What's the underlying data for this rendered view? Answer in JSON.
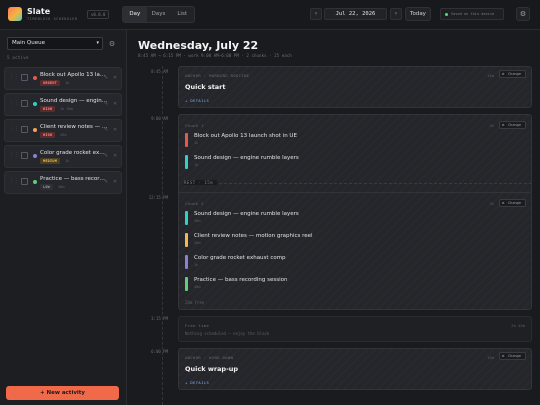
{
  "app": {
    "title": "Slate",
    "subtitle": "TIMEBLOCK SCHEDULER",
    "version": "v0.8.0"
  },
  "views": [
    {
      "label": "Day",
      "active": true
    },
    {
      "label": "Days",
      "active": false
    },
    {
      "label": "List",
      "active": false
    }
  ],
  "nav": {
    "prev_icon": "‹",
    "next_icon": "›",
    "date": "Jul 22, 2026",
    "today_label": "Today",
    "saved_status": "Saved on this device",
    "settings_icon": "⚙"
  },
  "sidebar": {
    "queue": "Main Queue",
    "queue_chevron": "▾",
    "gear_icon": "⚙",
    "active_count": "5 active",
    "tasks": [
      {
        "name": "Block out Apollo 13 launch shot in UE",
        "badge": "URGENT",
        "duration": "1h",
        "color": "#e25a4d",
        "badge_bg": "#5a2b2b",
        "badge_fg": "#ff8f82"
      },
      {
        "name": "Sound design — engine rumble layers",
        "badge": "HIGH",
        "duration": "1h 30m",
        "color": "#2fd1c5",
        "badge_bg": "#5a2b2b",
        "badge_fg": "#ff8f82"
      },
      {
        "name": "Client review notes — motion graphics reel",
        "badge": "HIGH",
        "duration": "45m",
        "color": "#f0a35a",
        "badge_bg": "#5a2b2b",
        "badge_fg": "#ff8f82"
      },
      {
        "name": "Color grade rocket exhaust comp",
        "badge": "MEDIUM",
        "duration": "1h",
        "color": "#8b7fd6",
        "badge_bg": "#4a3f1f",
        "badge_fg": "#f2c25a"
      },
      {
        "name": "Practice — bass recording session",
        "badge": "LOW",
        "duration": "40m",
        "color": "#5ccf7a",
        "badge_bg": "#2f3036",
        "badge_fg": "#a0a2ab"
      }
    ],
    "new_label": "+ New activity"
  },
  "main": {
    "day_title": "Wednesday, July 22",
    "meta": "8:45 AM → 6:15 PM · work 9:00 AM–6:00 PM · 2 chunks · 25 each",
    "times": [
      "8:45 AM",
      "9:00 AM",
      "12:15 PM",
      "3:15 PM",
      "6:00 PM"
    ],
    "anchor_start": {
      "label": "ANCHOR · MORNING ROUTINE",
      "duration": "15m",
      "title": "Quick start",
      "details": "+ DETAILS",
      "change": "Change"
    },
    "chunk1": {
      "label": "Chunk 1",
      "duration": "3h",
      "change": "Change",
      "entries": [
        {
          "title": "Block out Apollo 13 launch shot in UE",
          "duration": "1h",
          "color": "#e25a4d"
        },
        {
          "title": "Sound design — engine rumble layers",
          "duration": "1h",
          "color": "#2fd1c5"
        }
      ]
    },
    "rest": "REST · 15m",
    "chunk2": {
      "label": "Chunk 2",
      "duration": "3h",
      "change": "Change",
      "entries": [
        {
          "title": "Sound design — engine rumble layers",
          "duration": "30m",
          "color": "#2fd1c5"
        },
        {
          "title": "Client review notes — motion graphics reel",
          "duration": "45m",
          "color": "#f0b94a"
        },
        {
          "title": "Color grade rocket exhaust comp",
          "duration": "1h",
          "color": "#8b7fd6"
        },
        {
          "title": "Practice — bass recording session",
          "duration": "40m",
          "color": "#5ccf7a"
        }
      ],
      "slack": "20m free"
    },
    "free_time": {
      "label": "Free time",
      "duration": "2h 45m",
      "note": "Nothing scheduled — enjoy the black"
    },
    "anchor_end": {
      "label": "ANCHOR · WIND DOWN",
      "duration": "15m",
      "title": "Quick wrap-up",
      "details": "+ DETAILS",
      "change": "Change"
    }
  }
}
